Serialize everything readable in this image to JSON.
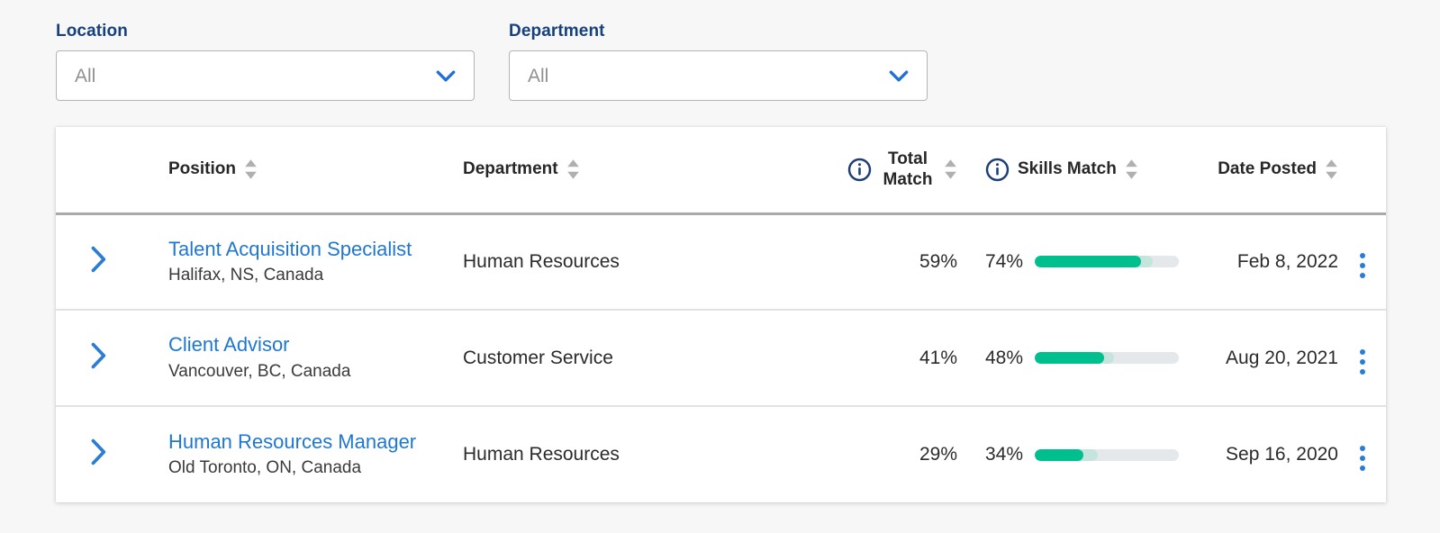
{
  "filters": [
    {
      "label": "Location",
      "value": "All",
      "icon": "chevron-down-icon",
      "name": "location"
    },
    {
      "label": "Department",
      "value": "All",
      "icon": "chevron-down-icon",
      "name": "department"
    }
  ],
  "table": {
    "columns": [
      {
        "key": "expand",
        "label": "",
        "sortable": false,
        "info": false
      },
      {
        "key": "position",
        "label": "Position",
        "sortable": true,
        "info": false
      },
      {
        "key": "dept",
        "label": "Department",
        "sortable": true,
        "info": false
      },
      {
        "key": "total",
        "label": "Total Match",
        "sortable": true,
        "info": true
      },
      {
        "key": "skills",
        "label": "Skills Match",
        "sortable": true,
        "info": true
      },
      {
        "key": "date",
        "label": "Date Posted",
        "sortable": true,
        "info": false
      },
      {
        "key": "menu",
        "label": "",
        "sortable": false,
        "info": false
      }
    ],
    "header": {
      "position": "Position",
      "department": "Department",
      "total_match_line1": "Total",
      "total_match_line2": "Match",
      "skills_match": "Skills Match",
      "date_posted": "Date Posted"
    },
    "rows": [
      {
        "position": "Talent Acquisition Specialist",
        "location": "Halifax, NS, Canada",
        "department": "Human Resources",
        "total_match": "59%",
        "skills_match": "74%",
        "skills_match_value": 74,
        "skills_secondary_value": 82,
        "date_posted": "Feb 8, 2022"
      },
      {
        "position": "Client Advisor",
        "location": "Vancouver, BC, Canada",
        "department": "Customer Service",
        "total_match": "41%",
        "skills_match": "48%",
        "skills_match_value": 48,
        "skills_secondary_value": 55,
        "date_posted": "Aug 20, 2021"
      },
      {
        "position": "Human Resources Manager",
        "location": "Old Toronto, ON, Canada",
        "department": "Human Resources",
        "total_match": "29%",
        "skills_match": "34%",
        "skills_match_value": 34,
        "skills_secondary_value": 44,
        "date_posted": "Sep 16, 2020"
      }
    ]
  },
  "icons": {
    "expand_row": "chevron-right-icon",
    "row_menu": "more-vertical-icon",
    "sort": "sort-arrows-icon",
    "info": "info-circle-icon"
  },
  "colors": {
    "label_navy": "#16417c",
    "link_blue": "#1f77d0",
    "accent_blue": "#2b7cd3",
    "progress_green": "#00bf8f",
    "progress_mint": "#c5e5dc",
    "progress_track": "#e4e8ea",
    "page_background": "#f7f7f7",
    "header_divider": "#a9a9a9",
    "row_divider": "#dfe3e8"
  }
}
